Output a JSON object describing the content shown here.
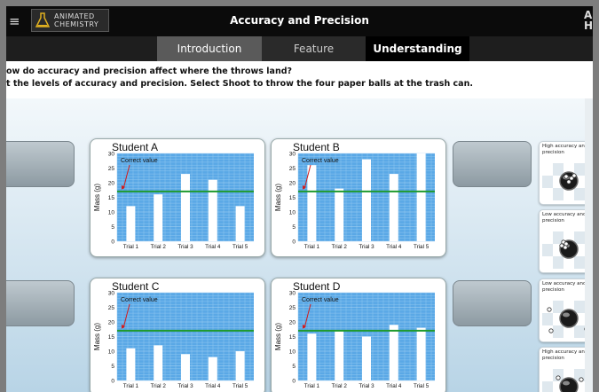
{
  "header": {
    "menu_icon": "≡",
    "logo_line1": "ANIMATED",
    "logo_line2": "CHEMISTRY",
    "title": "Accuracy and Precision",
    "corner_letters": "A\nH"
  },
  "tabs": [
    {
      "label": "Introduction"
    },
    {
      "label": "Feature"
    },
    {
      "label": "Understanding"
    }
  ],
  "instructions": {
    "question": "ow do accuracy and precision affect where the throws land?",
    "line2": "t the levels of accuracy and precision. Select Shoot to throw the four paper balls at the trash can."
  },
  "colors": {
    "grid_bg": "#5aa8e6",
    "correct_line": "#1f9a2e",
    "arrow": "#d01c1c"
  },
  "chart_data": [
    {
      "type": "bar",
      "title": "Student A",
      "ylabel": "Mass (g)",
      "annotation": "Correct value",
      "correct_value": 17,
      "ylim": [
        0,
        30
      ],
      "yticks": [
        0,
        5,
        10,
        15,
        20,
        25,
        30
      ],
      "categories": [
        "Trial 1",
        "Trial 2",
        "Trial 3",
        "Trial 4",
        "Trial 5"
      ],
      "values": [
        12,
        16,
        23,
        21,
        12
      ]
    },
    {
      "type": "bar",
      "title": "Student B",
      "ylabel": "Mass (g)",
      "annotation": "Correct value",
      "correct_value": 17,
      "ylim": [
        0,
        30
      ],
      "yticks": [
        0,
        5,
        10,
        15,
        20,
        25,
        30
      ],
      "categories": [
        "Trial 1",
        "Trial 2",
        "Trial 3",
        "Trial 4",
        "Trial 5"
      ],
      "values": [
        26,
        18,
        28,
        23,
        30
      ]
    },
    {
      "type": "bar",
      "title": "Student C",
      "ylabel": "Mass (g)",
      "annotation": "Correct value",
      "correct_value": 17,
      "ylim": [
        0,
        30
      ],
      "yticks": [
        0,
        5,
        10,
        15,
        20,
        25,
        30
      ],
      "categories": [
        "Trial 1",
        "Trial 2",
        "Trial 3",
        "Trial 4",
        "Trial 5"
      ],
      "values": [
        11,
        12,
        9,
        8,
        10
      ]
    },
    {
      "type": "bar",
      "title": "Student D",
      "ylabel": "Mass (g)",
      "annotation": "Correct value",
      "correct_value": 17,
      "ylim": [
        0,
        30
      ],
      "yticks": [
        0,
        5,
        10,
        15,
        20,
        25,
        30
      ],
      "categories": [
        "Trial 1",
        "Trial 2",
        "Trial 3",
        "Trial 4",
        "Trial 5"
      ],
      "values": [
        16,
        17,
        15,
        19,
        18
      ]
    }
  ],
  "thumbnails": [
    {
      "label": "High accuracy and precision",
      "pattern": "high-high"
    },
    {
      "label": "Low accuracy and precision",
      "pattern": "low-high"
    },
    {
      "label": "Low accuracy and precision",
      "pattern": "low-low"
    },
    {
      "label": "High accuracy and precision",
      "pattern": "high-low"
    }
  ]
}
